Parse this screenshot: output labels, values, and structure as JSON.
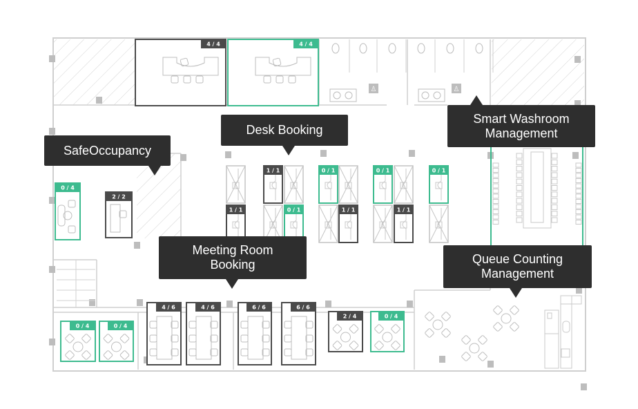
{
  "colors": {
    "available": "#3dbb8f",
    "occupied": "#4a4a4a",
    "inactive": "#c4c4c4",
    "callout": "#2e2e2e",
    "wall": "#cfcfcf"
  },
  "callouts": {
    "safe_occupancy": "SafeOccupancy",
    "desk_booking": "Desk Booking",
    "smart_washroom": "Smart Washroom Management",
    "meeting_room": "Meeting Room Booking",
    "queue_counting": "Queue Counting Management"
  },
  "top_rooms": [
    {
      "badge": "4 / 4",
      "status": "occupied"
    },
    {
      "badge": "4 / 4",
      "status": "available"
    }
  ],
  "safe_rooms": [
    {
      "badge": "0 / 4",
      "status": "available"
    },
    {
      "badge": "2 / 2",
      "status": "occupied"
    }
  ],
  "desks_row1": [
    {
      "status": "inactive"
    },
    {
      "badge": "1 / 1",
      "status": "occupied"
    },
    {
      "status": "inactive"
    },
    {
      "badge": "0 / 1",
      "status": "available"
    },
    {
      "status": "inactive"
    },
    {
      "badge": "0 / 1",
      "status": "available"
    },
    {
      "status": "inactive"
    },
    {
      "badge": "0 / 1",
      "status": "available"
    }
  ],
  "desks_row2": [
    {
      "badge": "1 / 1",
      "status": "occupied"
    },
    {
      "status": "inactive"
    },
    {
      "badge": "0 / 1",
      "status": "available"
    },
    {
      "status": "inactive"
    },
    {
      "badge": "1 / 1",
      "status": "occupied"
    },
    {
      "status": "inactive"
    },
    {
      "badge": "1 / 1",
      "status": "occupied"
    },
    {
      "status": "inactive"
    }
  ],
  "bottom_rooms": [
    {
      "badge": "0 / 4",
      "status": "available",
      "type": "round"
    },
    {
      "badge": "0 / 4",
      "status": "available",
      "type": "round"
    },
    {
      "badge": "4 / 6",
      "status": "occupied",
      "type": "table"
    },
    {
      "badge": "4 / 6",
      "status": "occupied",
      "type": "table"
    },
    {
      "badge": "6 / 6",
      "status": "occupied",
      "type": "table"
    },
    {
      "badge": "6 / 6",
      "status": "occupied",
      "type": "table"
    },
    {
      "badge": "2 / 4",
      "status": "occupied",
      "type": "round"
    },
    {
      "badge": "0 / 4",
      "status": "available",
      "type": "round"
    }
  ]
}
